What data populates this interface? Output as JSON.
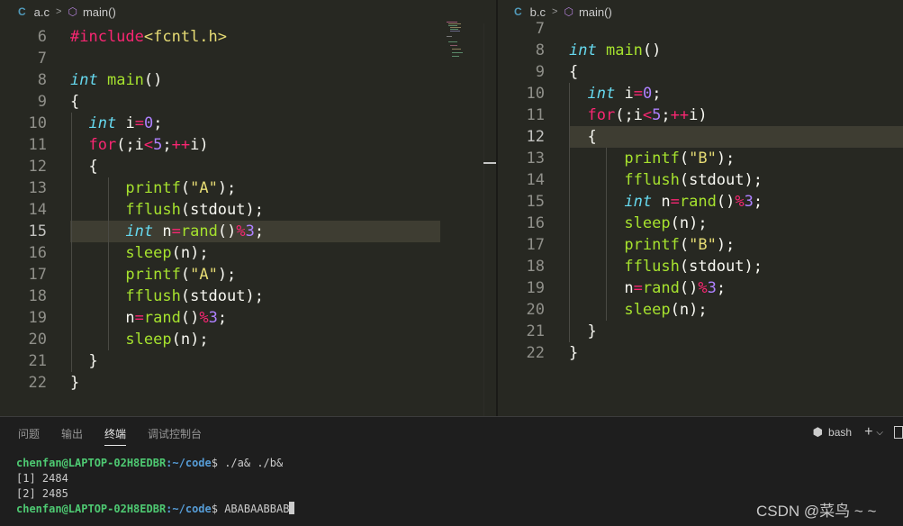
{
  "editor_a": {
    "filename": "a.c",
    "symbol": "main()",
    "active_line": "15",
    "lines": [
      {
        "n": "6",
        "tokens": [
          [
            "pp",
            "#include"
          ],
          [
            "str",
            "<fcntl.h>"
          ]
        ]
      },
      {
        "n": "7",
        "tokens": []
      },
      {
        "n": "8",
        "tokens": [
          [
            "kw",
            "int"
          ],
          [
            "tx",
            " "
          ],
          [
            "fn",
            "main"
          ],
          [
            "tx",
            "()"
          ]
        ]
      },
      {
        "n": "9",
        "tokens": [
          [
            "tx",
            "{"
          ]
        ]
      },
      {
        "n": "10",
        "tokens": [
          [
            "tx",
            "  "
          ],
          [
            "kw",
            "int"
          ],
          [
            "tx",
            " i"
          ],
          [
            "op",
            "="
          ],
          [
            "num",
            "0"
          ],
          [
            "tx",
            ";"
          ]
        ]
      },
      {
        "n": "11",
        "tokens": [
          [
            "tx",
            "  "
          ],
          [
            "op",
            "for"
          ],
          [
            "tx",
            "(;i"
          ],
          [
            "op",
            "<"
          ],
          [
            "num",
            "5"
          ],
          [
            "tx",
            ";"
          ],
          [
            "op",
            "++"
          ],
          [
            "tx",
            "i)"
          ]
        ]
      },
      {
        "n": "12",
        "tokens": [
          [
            "tx",
            "  {"
          ]
        ]
      },
      {
        "n": "13",
        "tokens": [
          [
            "tx",
            "      "
          ],
          [
            "fn",
            "printf"
          ],
          [
            "tx",
            "("
          ],
          [
            "str",
            "\"A\""
          ],
          [
            "tx",
            ");"
          ]
        ]
      },
      {
        "n": "14",
        "tokens": [
          [
            "tx",
            "      "
          ],
          [
            "fn",
            "fflush"
          ],
          [
            "tx",
            "(stdout);"
          ]
        ]
      },
      {
        "n": "15",
        "tokens": [
          [
            "tx",
            "      "
          ],
          [
            "kw",
            "int"
          ],
          [
            "tx",
            " n"
          ],
          [
            "op",
            "="
          ],
          [
            "fn",
            "rand"
          ],
          [
            "tx",
            "()"
          ],
          [
            "op",
            "%"
          ],
          [
            "num",
            "3"
          ],
          [
            "tx",
            ";"
          ]
        ]
      },
      {
        "n": "16",
        "tokens": [
          [
            "tx",
            "      "
          ],
          [
            "fn",
            "sleep"
          ],
          [
            "tx",
            "(n);"
          ]
        ]
      },
      {
        "n": "17",
        "tokens": [
          [
            "tx",
            "      "
          ],
          [
            "fn",
            "printf"
          ],
          [
            "tx",
            "("
          ],
          [
            "str",
            "\"A\""
          ],
          [
            "tx",
            ");"
          ]
        ]
      },
      {
        "n": "18",
        "tokens": [
          [
            "tx",
            "      "
          ],
          [
            "fn",
            "fflush"
          ],
          [
            "tx",
            "(stdout);"
          ]
        ]
      },
      {
        "n": "19",
        "tokens": [
          [
            "tx",
            "      n"
          ],
          [
            "op",
            "="
          ],
          [
            "fn",
            "rand"
          ],
          [
            "tx",
            "()"
          ],
          [
            "op",
            "%"
          ],
          [
            "num",
            "3"
          ],
          [
            "tx",
            ";"
          ]
        ]
      },
      {
        "n": "20",
        "tokens": [
          [
            "tx",
            "      "
          ],
          [
            "fn",
            "sleep"
          ],
          [
            "tx",
            "(n);"
          ]
        ]
      },
      {
        "n": "21",
        "tokens": [
          [
            "tx",
            "  }"
          ]
        ]
      },
      {
        "n": "22",
        "tokens": [
          [
            "tx",
            "}"
          ]
        ]
      }
    ]
  },
  "editor_b": {
    "filename": "b.c",
    "symbol": "main()",
    "active_line": "12",
    "lines": [
      {
        "n": "7",
        "tokens": []
      },
      {
        "n": "8",
        "tokens": [
          [
            "kw",
            "int"
          ],
          [
            "tx",
            " "
          ],
          [
            "fn",
            "main"
          ],
          [
            "tx",
            "()"
          ]
        ]
      },
      {
        "n": "9",
        "tokens": [
          [
            "tx",
            "{"
          ]
        ]
      },
      {
        "n": "10",
        "tokens": [
          [
            "tx",
            "  "
          ],
          [
            "kw",
            "int"
          ],
          [
            "tx",
            " i"
          ],
          [
            "op",
            "="
          ],
          [
            "num",
            "0"
          ],
          [
            "tx",
            ";"
          ]
        ]
      },
      {
        "n": "11",
        "tokens": [
          [
            "tx",
            "  "
          ],
          [
            "op",
            "for"
          ],
          [
            "tx",
            "(;i"
          ],
          [
            "op",
            "<"
          ],
          [
            "num",
            "5"
          ],
          [
            "tx",
            ";"
          ],
          [
            "op",
            "++"
          ],
          [
            "tx",
            "i)"
          ]
        ]
      },
      {
        "n": "12",
        "tokens": [
          [
            "tx",
            "  {"
          ]
        ]
      },
      {
        "n": "13",
        "tokens": [
          [
            "tx",
            "      "
          ],
          [
            "fn",
            "printf"
          ],
          [
            "tx",
            "("
          ],
          [
            "str",
            "\"B\""
          ],
          [
            "tx",
            ");"
          ]
        ]
      },
      {
        "n": "14",
        "tokens": [
          [
            "tx",
            "      "
          ],
          [
            "fn",
            "fflush"
          ],
          [
            "tx",
            "(stdout);"
          ]
        ]
      },
      {
        "n": "15",
        "tokens": [
          [
            "tx",
            "      "
          ],
          [
            "kw",
            "int"
          ],
          [
            "tx",
            " n"
          ],
          [
            "op",
            "="
          ],
          [
            "fn",
            "rand"
          ],
          [
            "tx",
            "()"
          ],
          [
            "op",
            "%"
          ],
          [
            "num",
            "3"
          ],
          [
            "tx",
            ";"
          ]
        ]
      },
      {
        "n": "16",
        "tokens": [
          [
            "tx",
            "      "
          ],
          [
            "fn",
            "sleep"
          ],
          [
            "tx",
            "(n);"
          ]
        ]
      },
      {
        "n": "17",
        "tokens": [
          [
            "tx",
            "      "
          ],
          [
            "fn",
            "printf"
          ],
          [
            "tx",
            "("
          ],
          [
            "str",
            "\"B\""
          ],
          [
            "tx",
            ");"
          ]
        ]
      },
      {
        "n": "18",
        "tokens": [
          [
            "tx",
            "      "
          ],
          [
            "fn",
            "fflush"
          ],
          [
            "tx",
            "(stdout);"
          ]
        ]
      },
      {
        "n": "19",
        "tokens": [
          [
            "tx",
            "      n"
          ],
          [
            "op",
            "="
          ],
          [
            "fn",
            "rand"
          ],
          [
            "tx",
            "()"
          ],
          [
            "op",
            "%"
          ],
          [
            "num",
            "3"
          ],
          [
            "tx",
            ";"
          ]
        ]
      },
      {
        "n": "20",
        "tokens": [
          [
            "tx",
            "      "
          ],
          [
            "fn",
            "sleep"
          ],
          [
            "tx",
            "(n);"
          ]
        ]
      },
      {
        "n": "21",
        "tokens": [
          [
            "tx",
            "  }"
          ]
        ]
      },
      {
        "n": "22",
        "tokens": [
          [
            "tx",
            "}"
          ]
        ]
      }
    ]
  },
  "panel": {
    "tabs": [
      "问题",
      "输出",
      "终端",
      "调试控制台"
    ],
    "active_tab": "终端",
    "shell": "bash",
    "icons": {
      "terminal": "terminal-icon",
      "add": "plus-icon",
      "dropdown": "chevron-down-icon",
      "split": "split-terminal-icon"
    }
  },
  "terminal": {
    "line1_user": "chenfan@LAPTOP-02H8EDBR",
    "line1_path": ":~/code",
    "line1_cmd": "$ ./a& ./b&",
    "line2": "[1] 2484",
    "line3": "[2] 2485",
    "line4_user": "chenfan@LAPTOP-02H8EDBR",
    "line4_path": ":~/code",
    "line4_out": "$ ABABAABBAB"
  },
  "watermark": "CSDN @菜鸟 ~ ~",
  "colors": {
    "editor_bg": "#272822",
    "line_highlight": "#3e3d32",
    "keyword": "#66d9ef",
    "function": "#a6e22e",
    "operator": "#f92672",
    "number": "#ae81ff",
    "string": "#e6db74"
  }
}
